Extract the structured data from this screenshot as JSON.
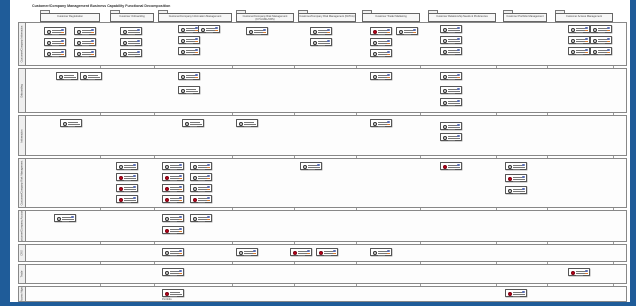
{
  "title": "Customer/Company Management Business Capability Functional Decomposition",
  "columns": [
    {
      "label": "Customer Registration"
    },
    {
      "label": "Customer Onboarding"
    },
    {
      "label": "Customer/Company Information Management"
    },
    {
      "label": "Customer/Company Risk Management (KYC/AML/CRS)"
    },
    {
      "label": "Customer/Company Risk Management (FATCA)"
    },
    {
      "label": "Customer Trade/ Marketing"
    },
    {
      "label": "Customer Relationship Needs & Preferences"
    },
    {
      "label": "Customer Portfolio Management"
    },
    {
      "label": "Customer Access Management"
    }
  ],
  "lanes": [
    {
      "label": "Customer/Company Information"
    },
    {
      "label": "Onboarding"
    },
    {
      "label": "Information"
    },
    {
      "label": "Customer/Company Risk Management"
    },
    {
      "label": "Customer/Company Accounts"
    },
    {
      "label": "CRS"
    },
    {
      "label": "Trade"
    },
    {
      "label": "Access Mgmt"
    }
  ],
  "footer_caption": "Portfolio"
}
